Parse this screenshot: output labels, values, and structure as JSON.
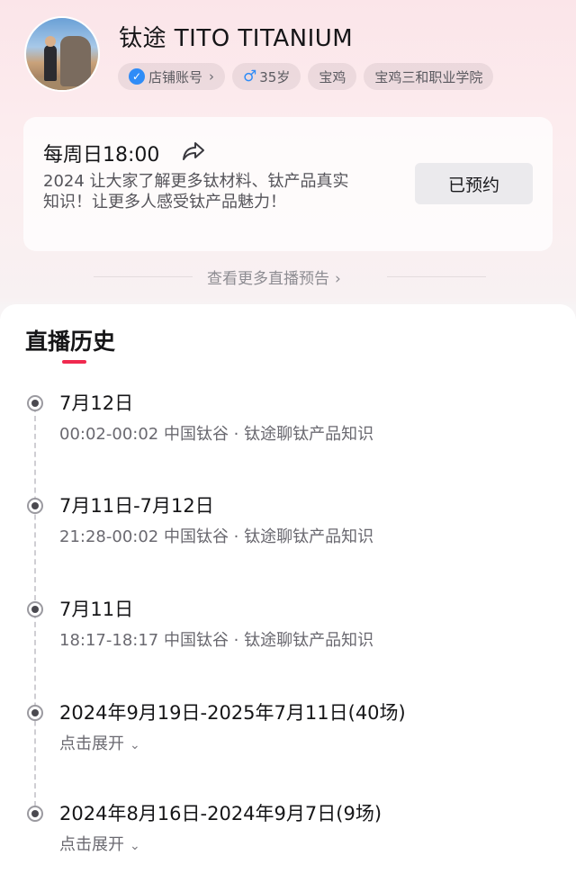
{
  "profile": {
    "name": "钛途 TITO TITANIUM",
    "tags": {
      "store_account": "店铺账号",
      "age": "35岁",
      "city": "宝鸡",
      "school": "宝鸡三和职业学院"
    }
  },
  "live_preview": {
    "time": "每周日18:00",
    "description": "2024 让大家了解更多钛材料、钛产品真实知识！让更多人感受钛产品魅力！",
    "button_label": "已预约"
  },
  "more_link": "查看更多直播预告",
  "history": {
    "title": "直播历史",
    "items": [
      {
        "date": "7月12日",
        "detail": "00:02-00:02 中国钛谷 · 钛途聊钛产品知识"
      },
      {
        "date": "7月11日-7月12日",
        "detail": "21:28-00:02 中国钛谷 · 钛途聊钛产品知识"
      },
      {
        "date": "7月11日",
        "detail": "18:17-18:17 中国钛谷 · 钛途聊钛产品知识"
      },
      {
        "date": "2024年9月19日-2025年7月11日(40场)",
        "detail": "点击展开"
      },
      {
        "date": "2024年8月16日-2024年9月7日(9场)",
        "detail": "点击展开"
      }
    ]
  },
  "colors": {
    "accent": "#f0294f",
    "verified_blue": "#2f8cf7"
  }
}
